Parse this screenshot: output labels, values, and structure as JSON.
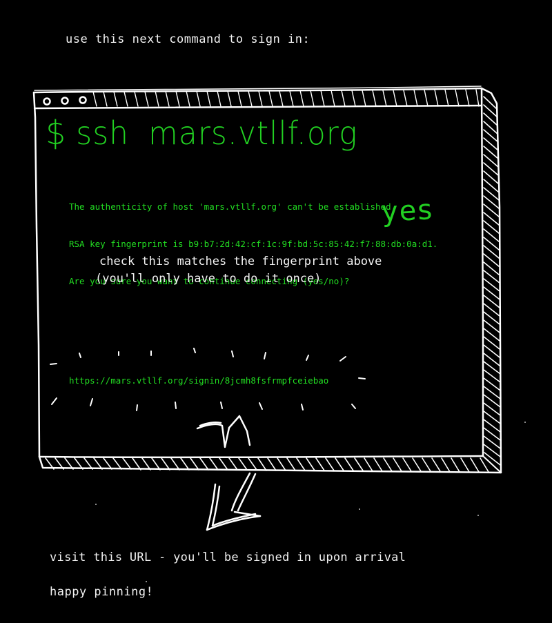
{
  "intro_text": "use this next command to sign in:",
  "window": {
    "controls": [
      "circle-icon",
      "circle-icon",
      "circle-icon"
    ]
  },
  "command": {
    "prompt": "$",
    "program": "ssh",
    "host": "mars.vtllf.org"
  },
  "terminal_lines": [
    "The authenticity of host 'mars.vtllf.org' can't be established.",
    "RSA key fingerprint is b9:b7:2d:42:cf:1c:9f:bd:5c:85:42:f7:88:db:0a:d1.",
    "Are you sure you want to continue connecting (yes/no)?"
  ],
  "answer": "yes",
  "note": [
    "check this matches the fingerprint above",
    "(you'll only have to do it once)"
  ],
  "signin_url": "https://mars.vtllf.org/signin/8jcmh8fsfrmpfceiebao",
  "visit_text": "visit this URL - you'll be signed in upon arrival",
  "closing_text": "happy pinning!",
  "colors": {
    "background": "#000000",
    "terminal_green": "#22dd22",
    "sketch_white": "#ffffff"
  }
}
